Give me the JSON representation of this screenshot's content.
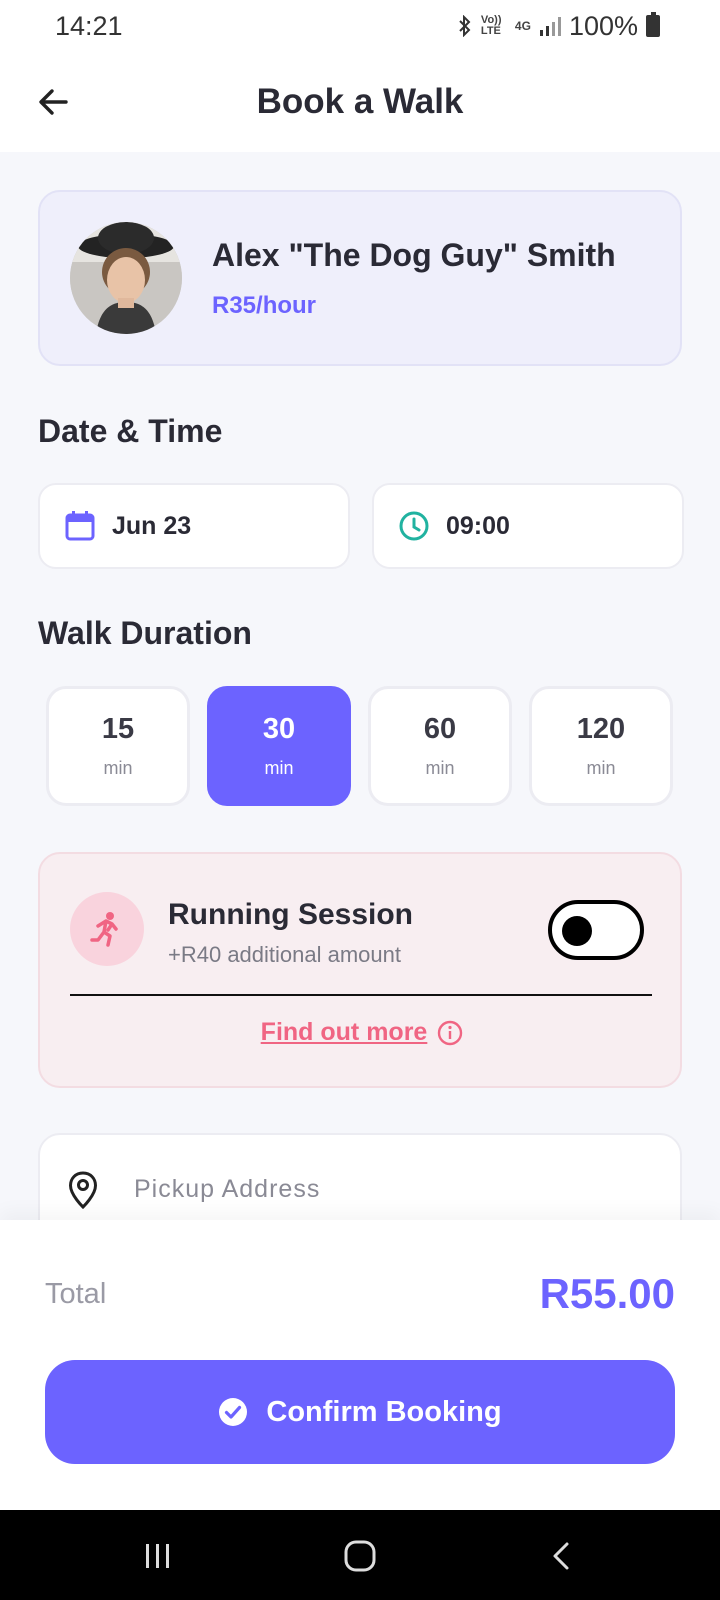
{
  "status_bar": {
    "time": "14:21",
    "network_labels": [
      "Vo)) LTE",
      "4G"
    ],
    "battery": "100%"
  },
  "header": {
    "title": "Book a Walk",
    "back_icon": "arrow-left-icon"
  },
  "walker": {
    "name": "Alex \"The Dog Guy\" Smith",
    "rate": "R35/hour"
  },
  "date_time": {
    "section_title": "Date & Time",
    "date": "Jun 23",
    "time": "09:00",
    "date_icon": "calendar-icon",
    "time_icon": "clock-icon"
  },
  "duration": {
    "section_title": "Walk Duration",
    "options": [
      {
        "value": "15",
        "unit": "min",
        "selected": false
      },
      {
        "value": "30",
        "unit": "min",
        "selected": true
      },
      {
        "value": "60",
        "unit": "min",
        "selected": false
      },
      {
        "value": "120",
        "unit": "min",
        "selected": false
      }
    ]
  },
  "running_session": {
    "title": "Running Session",
    "subtitle": "+R40 additional amount",
    "enabled": false,
    "find_out_more": "Find out more",
    "icon": "running-person-icon"
  },
  "pickup": {
    "placeholder": "Pickup Address",
    "value": "",
    "icon": "location-pin-icon"
  },
  "summary": {
    "total_label": "Total",
    "total_value": "R55.00",
    "confirm_label": "Confirm Booking"
  },
  "colors": {
    "accent": "#6C63FF",
    "running_accent": "#F06583",
    "time_icon": "#20B2A0"
  }
}
